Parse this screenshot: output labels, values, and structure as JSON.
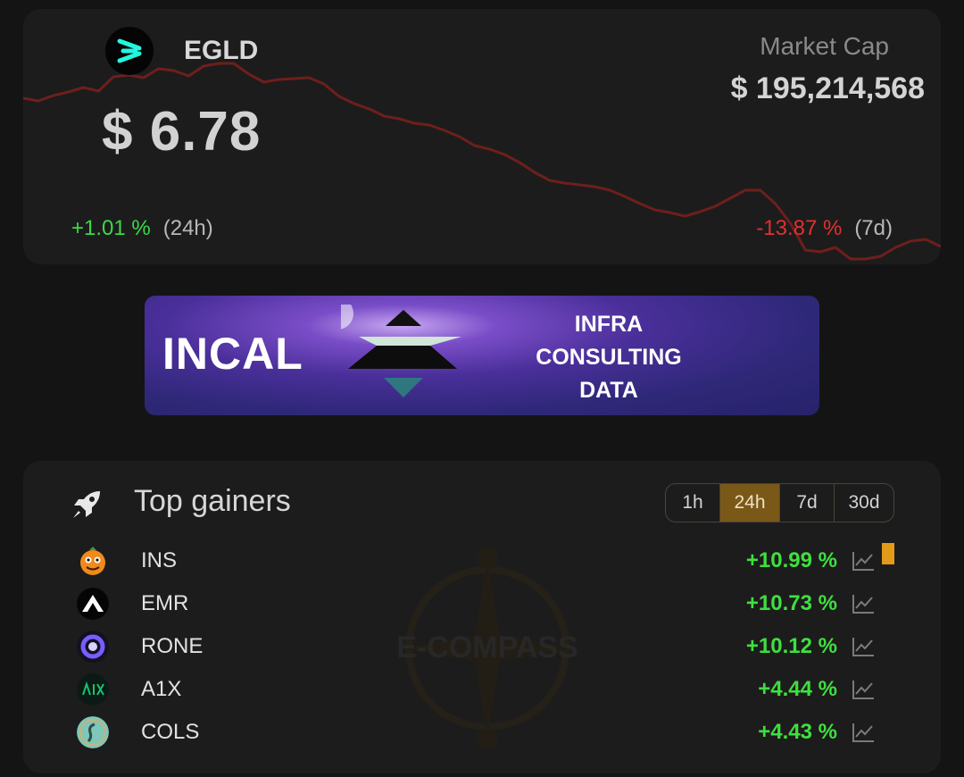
{
  "token": {
    "symbol": "EGLD",
    "logo_icon": "multiversx-x-icon",
    "price": "$ 6.78",
    "market_cap_label": "Market Cap",
    "market_cap_value": "$ 195,214,568",
    "change_24h": "+1.01 %",
    "change_24h_period": "(24h)",
    "change_7d": "-13.87 %",
    "change_7d_period": "(7d)",
    "sparkline_7d": [
      78,
      81,
      75,
      71,
      66,
      70,
      54,
      52,
      55,
      45,
      47,
      53,
      42,
      39,
      39,
      51,
      60,
      57,
      56,
      55,
      62,
      76,
      84,
      90,
      98,
      101,
      106,
      108,
      114,
      121,
      131,
      135,
      141,
      150,
      161,
      170,
      173,
      175,
      177,
      181,
      188,
      196,
      203,
      206,
      210,
      205,
      199,
      190,
      181,
      181,
      196,
      218,
      248,
      250,
      245,
      258,
      258,
      255,
      245,
      238,
      236,
      244
    ]
  },
  "banner": {
    "brand": "INCAL",
    "lines": [
      "INFRA",
      "CONSULTING",
      "DATA"
    ]
  },
  "gainers": {
    "title": "Top gainers",
    "timeframes": [
      "1h",
      "24h",
      "7d",
      "30d"
    ],
    "active_timeframe": "24h",
    "watermark_text": "E-COMPASS",
    "rows": [
      {
        "symbol": "INS",
        "change": "+10.99 %",
        "logo_icon": "ins-mascot-icon",
        "logo_color": "#f08a1c"
      },
      {
        "symbol": "EMR",
        "change": "+10.73 %",
        "logo_icon": "emr-mountain-icon",
        "logo_color": "#ffffff"
      },
      {
        "symbol": "RONE",
        "change": "+10.12 %",
        "logo_icon": "rone-ring-icon",
        "logo_color": "#7a5cff"
      },
      {
        "symbol": "A1X",
        "change": "+4.44 %",
        "logo_icon": "a1x-icon",
        "logo_color": "#19c26e"
      },
      {
        "symbol": "COLS",
        "change": "+4.43 %",
        "logo_icon": "cols-seahorse-icon",
        "logo_color": "#7fc7b8"
      }
    ]
  },
  "colors": {
    "positive": "#3ee03e",
    "negative": "#e0322e",
    "accent": "#7a5818",
    "sparkline": "#6e1f1c"
  }
}
